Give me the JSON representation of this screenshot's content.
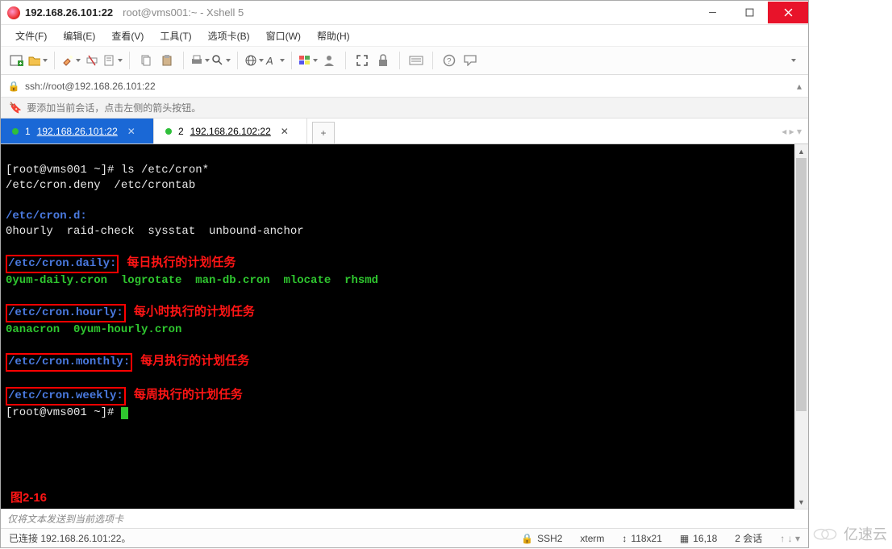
{
  "title": {
    "host": "192.168.26.101:22",
    "sub": "root@vms001:~ - Xshell 5"
  },
  "menu": {
    "file": "文件(F)",
    "edit": "编辑(E)",
    "view": "查看(V)",
    "tools": "工具(T)",
    "tabs": "选项卡(B)",
    "window": "窗口(W)",
    "help": "帮助(H)"
  },
  "address": {
    "scheme_icon": "🔒",
    "url": "ssh://root@192.168.26.101:22"
  },
  "hint": {
    "icon": "🔖",
    "text": "要添加当前会话，点击左侧的箭头按钮。"
  },
  "tabs": [
    {
      "num": "1",
      "label": "192.168.26.101:22",
      "active": true
    },
    {
      "num": "2",
      "label": "192.168.26.102:22",
      "active": false
    }
  ],
  "term": {
    "prompt1": "[root@vms001 ~]# ls /etc/cron*",
    "line_deny": "/etc/cron.deny  /etc/crontab",
    "crond_hdr": "/etc/cron.d:",
    "crond_list": "0hourly  raid-check  sysstat  unbound-anchor",
    "daily_hdr": "/etc/cron.daily:",
    "daily_note": "每日执行的计划任务",
    "daily_list": "0yum-daily.cron  logrotate  man-db.cron  mlocate  rhsmd",
    "hourly_hdr": "/etc/cron.hourly:",
    "hourly_note": "每小时执行的计划任务",
    "hourly_list": "0anacron  0yum-hourly.cron",
    "monthly_hdr": "/etc/cron.monthly:",
    "monthly_note": "每月执行的计划任务",
    "weekly_hdr": "/etc/cron.weekly:",
    "weekly_note": "每周执行的计划任务",
    "prompt2": "[root@vms001 ~]# ",
    "figure": "图2-16"
  },
  "sendline": "仅将文本发送到当前选项卡",
  "status": {
    "conn": "已连接 192.168.26.101:22。",
    "proto": "SSH2",
    "term": "xterm",
    "size": "118x21",
    "pos": "16,18",
    "sessions": "2 会话"
  },
  "watermark": "亿速云"
}
